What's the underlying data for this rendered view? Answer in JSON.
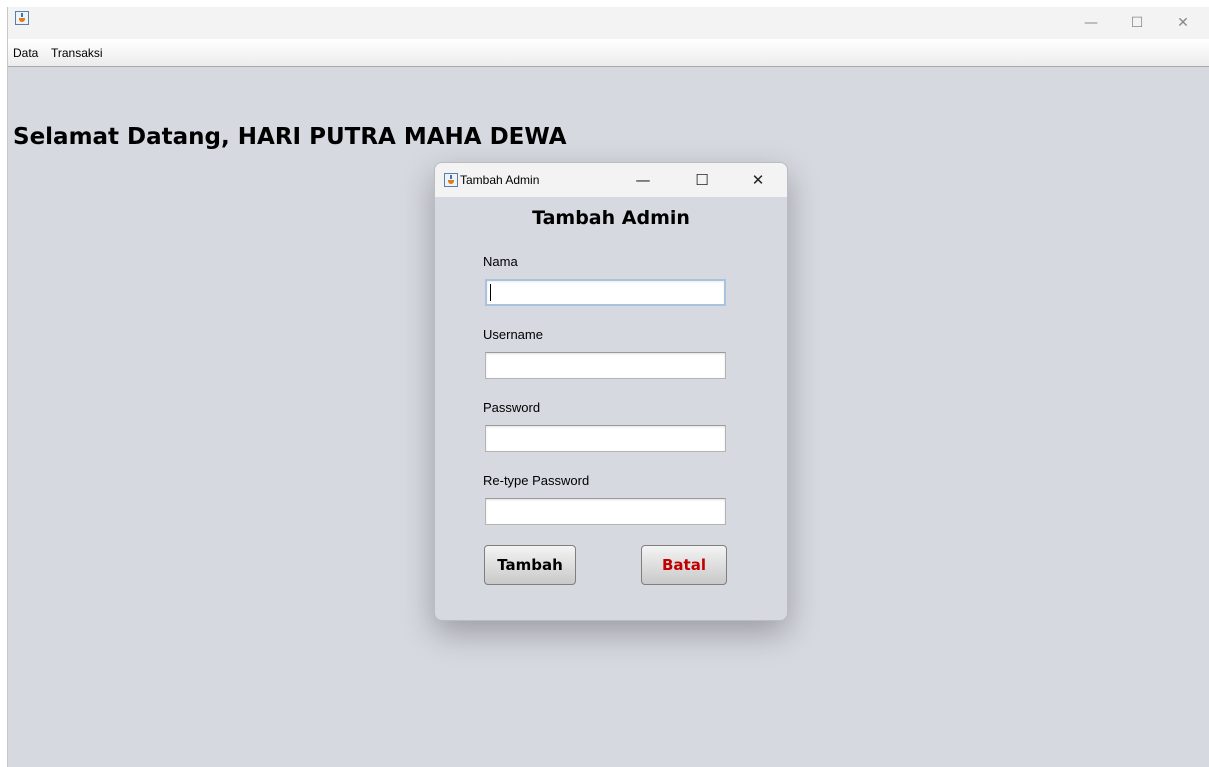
{
  "main_window": {
    "menu": [
      "Data",
      "Transaksi"
    ],
    "controls": {
      "minimize": "—",
      "maximize": "☐",
      "close": "✕"
    },
    "welcome_text": "Selamat Datang, HARI PUTRA MAHA DEWA"
  },
  "dialog": {
    "window_title": "Tambah Admin",
    "controls": {
      "minimize": "—",
      "maximize": "☐",
      "close": "✕"
    },
    "form_title": "Tambah Admin",
    "fields": [
      {
        "label": "Nama",
        "value": ""
      },
      {
        "label": "Username",
        "value": ""
      },
      {
        "label": "Password",
        "value": ""
      },
      {
        "label": "Re-type Password",
        "value": ""
      }
    ],
    "buttons": {
      "tambah": "Tambah",
      "batal": "Batal"
    },
    "colors": {
      "batal_text": "#c00000",
      "focus_border": "#a9c3df"
    }
  }
}
